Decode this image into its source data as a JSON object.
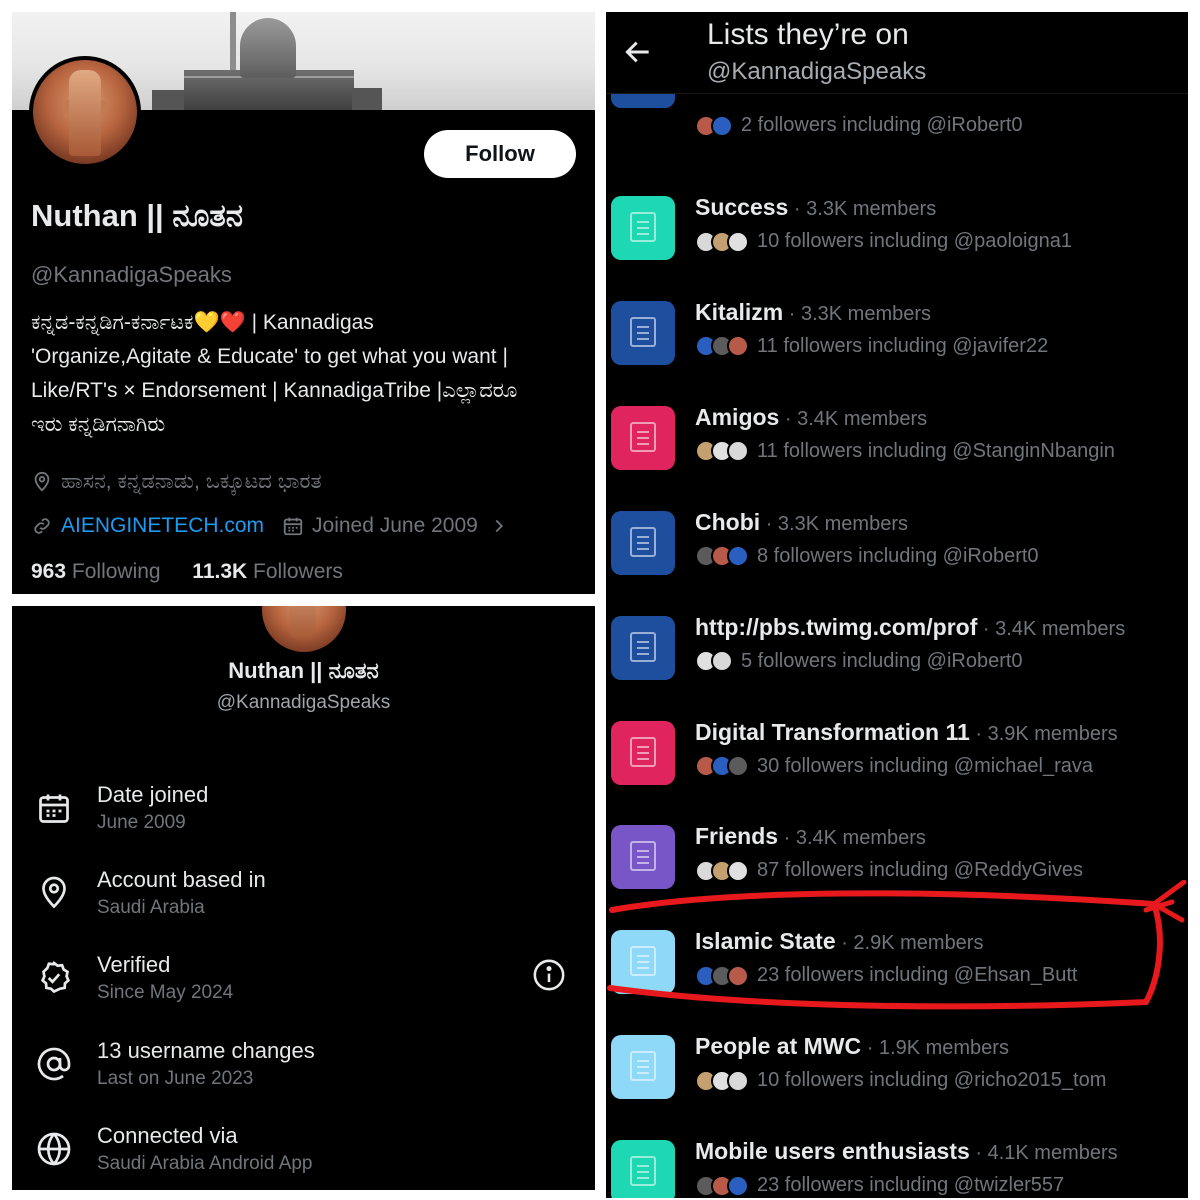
{
  "profile": {
    "follow_label": "Follow",
    "name": "Nuthan || ನೂತನ",
    "handle": "@KannadigaSpeaks",
    "bio_lines": [
      "ಕನ್ನಡ-ಕನ್ನಡಿಗ-ಕರ್ನಾಟಕ💛❤️ | Kannadigas",
      "'Organize,Agitate & Educate' to get what you want |",
      "Like/RT's × Endorsement | KannadigaTribe |ಎಲ್ಲಾದರೂ",
      "ಇರು ಕನ್ನಡಿಗನಾಗಿರು"
    ],
    "location": "ಹಾಸನ, ಕನ್ನಡನಾಡು, ಒಕ್ಕೂಟದ ಭಾರತ",
    "website": "AIENGINETECH.com",
    "joined": "Joined June 2009",
    "following_count": "963",
    "following_label": "Following",
    "followers_count": "11.3K",
    "followers_label": "Followers"
  },
  "about": {
    "name": "Nuthan || ನೂತನ",
    "handle": "@KannadigaSpeaks",
    "items": [
      {
        "title": "Date joined",
        "subtitle": "June 2009",
        "icon": "calendar-icon"
      },
      {
        "title": "Account based in",
        "subtitle": "Saudi Arabia",
        "icon": "location-pin-icon"
      },
      {
        "title": "Verified",
        "subtitle": "Since May 2024",
        "icon": "verified-badge-icon"
      },
      {
        "title": "13 username changes",
        "subtitle": "Last on June 2023",
        "icon": "at-sign-icon"
      },
      {
        "title": "Connected via",
        "subtitle": "Saudi Arabia Android App",
        "icon": "globe-icon"
      }
    ]
  },
  "lists_page": {
    "title": "Lists they’re on",
    "handle": "@KannadigaSpeaks",
    "items": [
      {
        "name": "",
        "members": "",
        "followers_text": "2 followers including @iRobert0",
        "color": "#1d4f9e"
      },
      {
        "name": "Success",
        "members": "· 3.3K members",
        "followers_text": "10 followers including @paoloigna1",
        "color": "#1ed8b4"
      },
      {
        "name": "Kitalizm",
        "members": "· 3.3K members",
        "followers_text": "11 followers including @javifer22",
        "color": "#1d4f9e"
      },
      {
        "name": "Amigos",
        "members": "· 3.4K members",
        "followers_text": "11 followers including @StanginNbangin",
        "color": "#e0245e"
      },
      {
        "name": "Chobi",
        "members": "· 3.3K members",
        "followers_text": "8 followers including @iRobert0",
        "color": "#1d4f9e"
      },
      {
        "name": "http://pbs.twimg.com/prof",
        "members": "· 3.4K members",
        "followers_text": "5 followers including @iRobert0",
        "color": "#1d4f9e"
      },
      {
        "name": "Digital Transformation 11",
        "members": "· 3.9K members",
        "followers_text": "30 followers including @michael_rava",
        "color": "#e0245e"
      },
      {
        "name": "Friends",
        "members": "· 3.4K members",
        "followers_text": "87 followers including @ReddyGives",
        "color": "#7856c7"
      },
      {
        "name": "Islamic State",
        "members": "· 2.9K members",
        "followers_text": "23 followers including @Ehsan_Butt",
        "color": "#8ed8f8"
      },
      {
        "name": "People at MWC",
        "members": "· 1.9K members",
        "followers_text": "10 followers including @richo2015_tom",
        "color": "#8ed8f8"
      },
      {
        "name": "Mobile users enthusiasts",
        "members": "· 4.1K members",
        "followers_text": "23 followers including @twizler557",
        "color": "#1ed8b4"
      }
    ]
  },
  "colors": {
    "background": "#000000",
    "text_primary": "#e7e9ea",
    "text_secondary": "#71767b",
    "link": "#1d9bf0",
    "annotation_red": "#e8191c"
  }
}
